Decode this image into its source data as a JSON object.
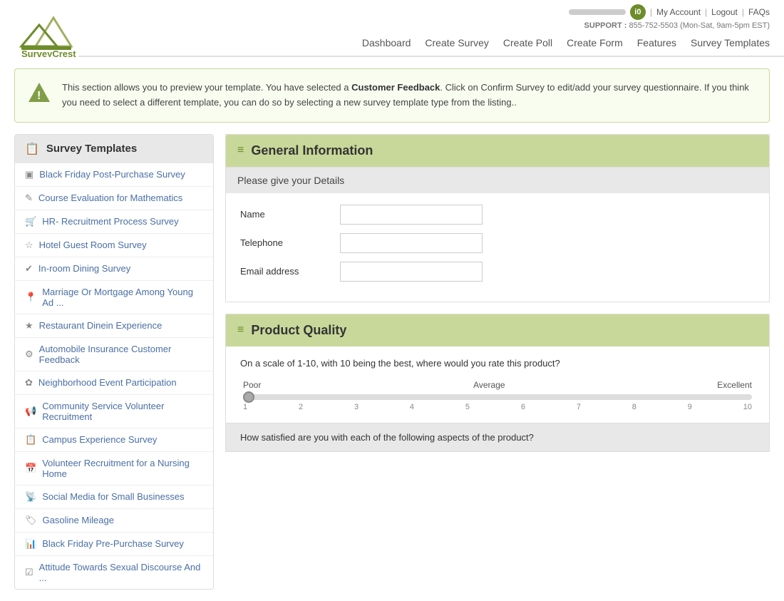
{
  "header": {
    "logo_text": "SurveyCrest",
    "progress_label": "progress",
    "user_icon": "i0",
    "my_account": "My Account",
    "logout": "Logout",
    "faqs": "FAQs",
    "support_label": "SUPPORT :",
    "support_phone": "855-752-5503 (Mon-Sat, 9am-5pm EST)"
  },
  "nav": {
    "items": [
      {
        "label": "Dashboard",
        "href": "#"
      },
      {
        "label": "Create Survey",
        "href": "#"
      },
      {
        "label": "Create Poll",
        "href": "#"
      },
      {
        "label": "Create Form",
        "href": "#"
      },
      {
        "label": "Features",
        "href": "#"
      },
      {
        "label": "Survey Templates",
        "href": "#"
      }
    ]
  },
  "info_banner": {
    "text_before": "This section allows you to preview your template. You have selected a ",
    "highlight": "Customer Feedback",
    "text_after": ". Click on Confirm Survey to edit/add your survey questionnaire. If you think you need to select a different template, you can do so by selecting a new survey template type from the listing.."
  },
  "sidebar": {
    "title": "Survey Templates",
    "items": [
      {
        "label": "Black Friday Post-Purchase Survey",
        "icon": "▣"
      },
      {
        "label": "Course Evaluation for Mathematics",
        "icon": "✎"
      },
      {
        "label": "HR- Recruitment Process Survey",
        "icon": "🛒"
      },
      {
        "label": "Hotel Guest Room Survey",
        "icon": "☆"
      },
      {
        "label": "In-room Dining Survey",
        "icon": "✔"
      },
      {
        "label": "Marriage Or Mortgage Among Young Ad ...",
        "icon": "📍"
      },
      {
        "label": "Restaurant Dinein Experience",
        "icon": "★"
      },
      {
        "label": "Automobile Insurance Customer Feedback",
        "icon": "⚙"
      },
      {
        "label": "Neighborhood Event Participation",
        "icon": "✿"
      },
      {
        "label": "Community Service Volunteer Recruitment",
        "icon": "📢"
      },
      {
        "label": "Campus Experience Survey",
        "icon": "📋"
      },
      {
        "label": "Volunteer Recruitment for a Nursing Home",
        "icon": "📅"
      },
      {
        "label": "Social Media for Small Businesses",
        "icon": "📡"
      },
      {
        "label": "Gasoline Mileage",
        "icon": "🏷"
      },
      {
        "label": "Black Friday Pre-Purchase Survey",
        "icon": "📊"
      },
      {
        "label": "Attitude Towards Sexual Discourse And ...",
        "icon": "☑"
      }
    ]
  },
  "general_info": {
    "section_title": "General Information",
    "subsection_title": "Please give your Details",
    "fields": [
      {
        "label": "Name",
        "placeholder": ""
      },
      {
        "label": "Telephone",
        "placeholder": ""
      },
      {
        "label": "Email address",
        "placeholder": ""
      }
    ]
  },
  "product_quality": {
    "section_title": "Product Quality",
    "scale_question": "On a scale of 1-10, with 10 being the best, where would you rate this product?",
    "scale_labels": [
      "Poor",
      "Average",
      "Excellent"
    ],
    "scale_numbers": [
      "1",
      "2",
      "3",
      "4",
      "5",
      "6",
      "7",
      "8",
      "9",
      "10"
    ],
    "satisfied_question": "How satisfied are you with each of the following aspects of the product?"
  }
}
